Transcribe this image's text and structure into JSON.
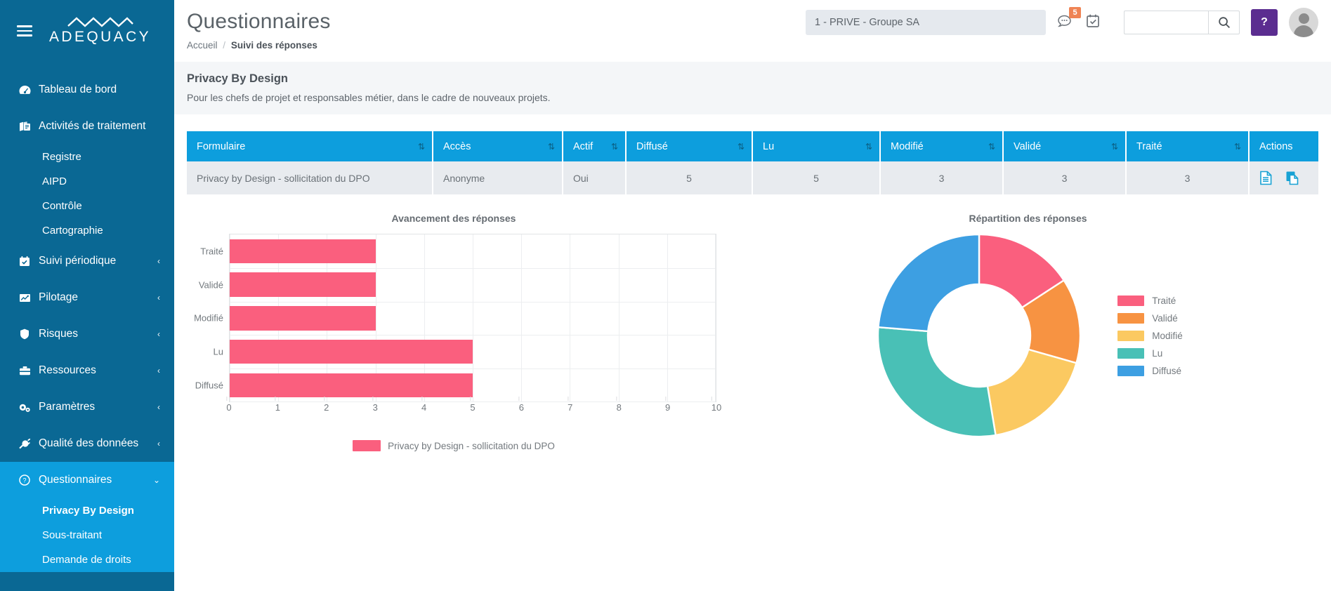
{
  "brand": {
    "name": "ADEQUACY",
    "logo_icon": "mountains-icon",
    "menu_icon": "hamburger-icon"
  },
  "sidebar": {
    "items": [
      {
        "label": "Tableau de bord",
        "icon": "dashboard-icon",
        "chevron": "",
        "children": []
      },
      {
        "label": "Activités de traitement",
        "icon": "book-icon",
        "chevron": "",
        "children": [
          "Registre",
          "AIPD",
          "Contrôle",
          "Cartographie"
        ]
      },
      {
        "label": "Suivi périodique",
        "icon": "calendar-check-icon",
        "chevron": "‹",
        "children": []
      },
      {
        "label": "Pilotage",
        "icon": "chart-line-icon",
        "chevron": "‹",
        "children": []
      },
      {
        "label": "Risques",
        "icon": "shield-icon",
        "chevron": "‹",
        "children": []
      },
      {
        "label": "Ressources",
        "icon": "briefcase-icon",
        "chevron": "‹",
        "children": []
      },
      {
        "label": "Paramètres",
        "icon": "gears-icon",
        "chevron": "‹",
        "children": []
      },
      {
        "label": "Qualité des données",
        "icon": "plug-icon",
        "chevron": "‹",
        "children": []
      },
      {
        "label": "Questionnaires",
        "icon": "question-circle-icon",
        "chevron": "⌄",
        "children": [
          "Privacy By Design",
          "Sous-traitant",
          "Demande de droits"
        ]
      }
    ],
    "active_item": "Questionnaires",
    "active_child": "Privacy By Design",
    "colors": {
      "bg": "#0a6894",
      "active": "#0d9edd"
    }
  },
  "header": {
    "title": "Questionnaires",
    "breadcrumb": {
      "home": "Accueil",
      "separator": "/",
      "current": "Suivi des réponses"
    },
    "org_select": {
      "value": "1 - PRIVE - Groupe SA"
    },
    "messages": {
      "icon": "comment-dots-icon",
      "badge": "5"
    },
    "calendar": {
      "icon": "calendar-check-icon"
    },
    "search": {
      "value": "",
      "placeholder": "",
      "icon": "search-icon"
    },
    "help": {
      "label": "?",
      "color": "#5b2d90"
    },
    "avatar": {
      "icon": "user-avatar-icon"
    }
  },
  "description": {
    "title": "Privacy By Design",
    "text": "Pour les chefs de projet et responsables métier, dans le cadre de nouveaux projets."
  },
  "table": {
    "columns": [
      {
        "label": "Formulaire",
        "sortable": true
      },
      {
        "label": "Accès",
        "sortable": true
      },
      {
        "label": "Actif",
        "sortable": true
      },
      {
        "label": "Diffusé",
        "sortable": true
      },
      {
        "label": "Lu",
        "sortable": true
      },
      {
        "label": "Modifié",
        "sortable": true
      },
      {
        "label": "Validé",
        "sortable": true
      },
      {
        "label": "Traité",
        "sortable": true
      },
      {
        "label": "Actions",
        "sortable": false
      }
    ],
    "rows": [
      {
        "formulaire": "Privacy by Design - sollicitation du DPO",
        "acces": "Anonyme",
        "actif": "Oui",
        "diffuse": "5",
        "lu": "5",
        "modifie": "3",
        "valide": "3",
        "traite": "3",
        "actions": [
          {
            "icon": "file-lines-icon"
          },
          {
            "icon": "copy-icon"
          }
        ]
      }
    ],
    "header_color": "#0d9edd",
    "row_color": "#e8ebef"
  },
  "chart_data": [
    {
      "type": "bar",
      "orientation": "horizontal",
      "title": "Avancement des réponses",
      "categories": [
        "Traité",
        "Validé",
        "Modifié",
        "Lu",
        "Diffusé"
      ],
      "values": [
        3,
        3,
        3,
        5,
        5
      ],
      "series": [
        {
          "name": "Privacy by Design - sollicitation du DPO",
          "values": [
            3,
            3,
            3,
            5,
            5
          ],
          "color": "#fa5f7e"
        }
      ],
      "xlabel": "",
      "ylabel": "",
      "xlim": [
        0,
        10
      ],
      "xticks": [
        "0",
        "1",
        "2",
        "3",
        "4",
        "5",
        "6",
        "7",
        "8",
        "9",
        "10"
      ],
      "grid": true,
      "legend_position": "bottom",
      "legend": [
        "Privacy by Design - sollicitation du DPO"
      ]
    },
    {
      "type": "pie",
      "variant": "donut",
      "title": "Répartition des réponses",
      "categories": [
        "Traité",
        "Validé",
        "Modifié",
        "Lu",
        "Diffusé"
      ],
      "values": [
        3,
        3,
        3,
        5,
        5
      ],
      "colors": [
        "#fa5f7e",
        "#f79342",
        "#fbc961",
        "#49c0b6",
        "#3d9fe2"
      ],
      "legend_position": "right",
      "legend": [
        "Traité",
        "Validé",
        "Modifié",
        "Lu",
        "Diffusé"
      ]
    }
  ]
}
